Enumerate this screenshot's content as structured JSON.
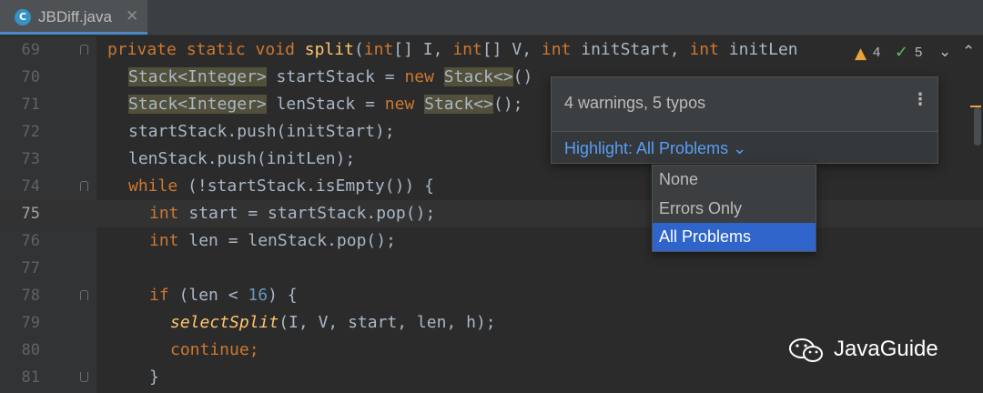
{
  "tab": {
    "icon_letter": "C",
    "icon": "java-class-icon",
    "label": "JBDiff.java",
    "close": "✕"
  },
  "lines": [
    {
      "n": "69"
    },
    {
      "n": "70"
    },
    {
      "n": "71"
    },
    {
      "n": "72"
    },
    {
      "n": "73"
    },
    {
      "n": "74"
    },
    {
      "n": "75"
    },
    {
      "n": "76"
    },
    {
      "n": "77"
    },
    {
      "n": "78"
    },
    {
      "n": "79"
    },
    {
      "n": "80"
    },
    {
      "n": "81"
    }
  ],
  "code": {
    "l69": {
      "kw1": "private static void ",
      "fn": "split",
      "p1": "(",
      "kw2": "int",
      "p2": "[] I, ",
      "kw3": "int",
      "p3": "[] V, ",
      "kw4": "int",
      "p4": " initStart, ",
      "kw5": "int",
      "p5": " initLen"
    },
    "l70": {
      "t1": "Stack<Integer>",
      "t2": " startStack = ",
      "kw": "new",
      "t3": " ",
      "t4": "Stack<>",
      "t5": "()"
    },
    "l71": {
      "t1": "Stack<Integer>",
      "t2": " lenStack = ",
      "kw": "new",
      "t3": " ",
      "t4": "Stack<>",
      "t5": "();"
    },
    "l72": "startStack.push(initStart);",
    "l73": "lenStack.push(initLen);",
    "l74": {
      "kw": "while",
      "t": " (!startStack.isEmpty()) {"
    },
    "l75": {
      "kw": "int",
      "t": " start = startStack.pop();"
    },
    "l76": {
      "kw": "int",
      "t": " len = lenStack.pop();"
    },
    "l78": {
      "kw": "if",
      "t1": " (len < ",
      "num": "16",
      "t2": ") {"
    },
    "l79": {
      "fn": "selectSplit",
      "t": "(I, V, start, len, h);"
    },
    "l80": "continue;",
    "l81": "}"
  },
  "inspection": {
    "warn_icon": "warning-icon",
    "warnings": "4",
    "typo_icon": "typo-check-icon",
    "typos": "5",
    "next": "⌄",
    "prev": "⌃"
  },
  "popup": {
    "title": "4 warnings, 5 typos",
    "menu": "⋮",
    "highlight": "Highlight: All Problems ⌄"
  },
  "dropdown": {
    "options": [
      "None",
      "Errors Only",
      "All Problems"
    ],
    "selected": "All Problems"
  },
  "watermark": {
    "icon": "wechat-icon",
    "text": "JavaGuide"
  },
  "colors": {
    "keyword": "#cc7832",
    "function": "#ffc66d",
    "number": "#6897bb",
    "text": "#a9b7c6",
    "link": "#589df6",
    "selection": "#2f65ca",
    "warning": "#e8a33d",
    "ok": "#5fb85c"
  }
}
